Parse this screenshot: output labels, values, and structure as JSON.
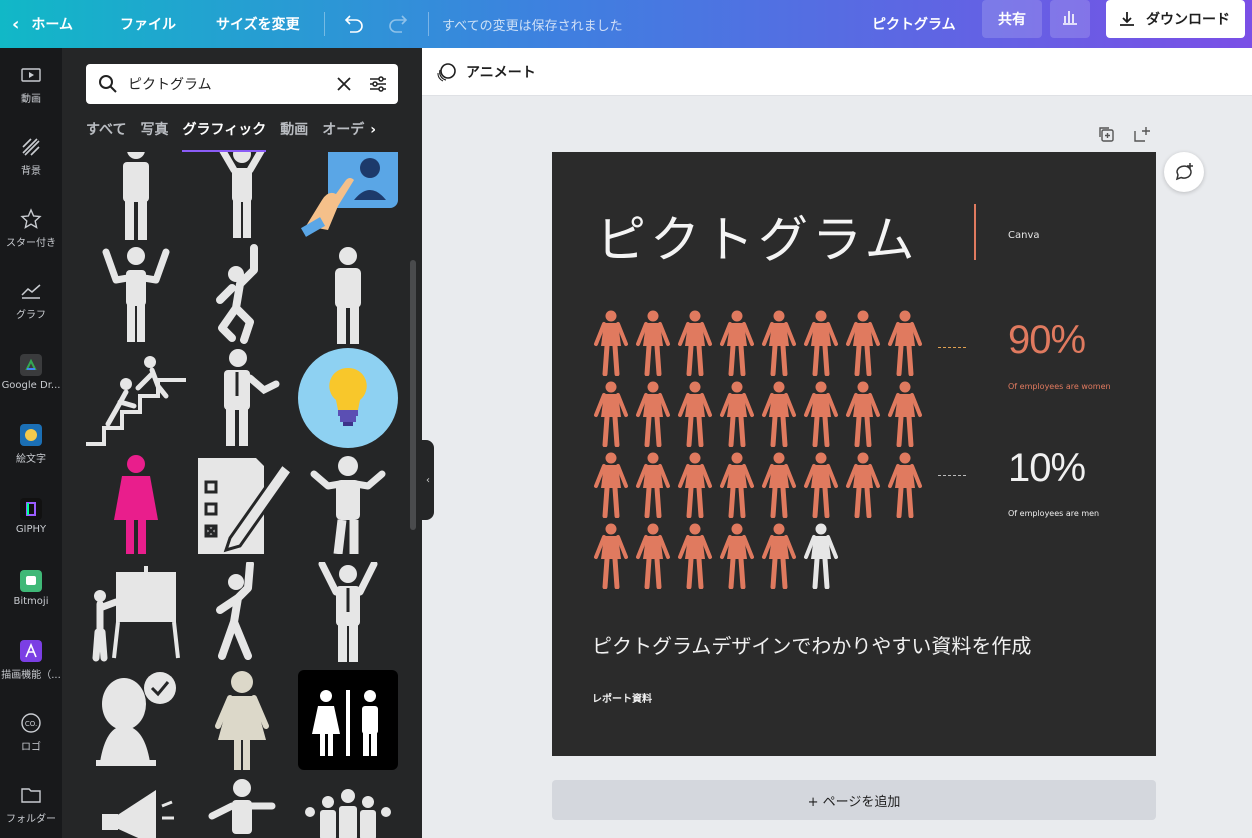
{
  "topbar": {
    "home_label": "ホーム",
    "file_label": "ファイル",
    "resize_label": "サイズを変更",
    "save_status": "すべての変更は保存されました",
    "doc_title": "ピクトグラム",
    "share_label": "共有",
    "download_label": "ダウンロード",
    "gradient_colors": [
      "#11b8c7",
      "#3f7fe0",
      "#7a4fe6"
    ]
  },
  "rail": {
    "items": [
      {
        "label": "動画",
        "icon": "video-icon"
      },
      {
        "label": "背景",
        "icon": "background-icon"
      },
      {
        "label": "スター付き",
        "icon": "star-icon"
      },
      {
        "label": "グラフ",
        "icon": "chart-icon"
      },
      {
        "label": "Google Dr...",
        "icon": "google-drive-icon"
      },
      {
        "label": "絵文字",
        "icon": "emoji-icon"
      },
      {
        "label": "GIPHY",
        "icon": "giphy-icon"
      },
      {
        "label": "Bitmoji",
        "icon": "bitmoji-icon"
      },
      {
        "label": "描画機能（...",
        "icon": "draw-icon"
      },
      {
        "label": "ロゴ",
        "icon": "logo-icon"
      },
      {
        "label": "フォルダー",
        "icon": "folder-icon"
      }
    ]
  },
  "panel": {
    "search_value": "ピクトグラム",
    "tabs": [
      "すべて",
      "写真",
      "グラフィック",
      "動画",
      "オーデ"
    ],
    "active_tab": "グラフィック",
    "active_tab_color": "#8b5cf6",
    "results": [
      "standing-person-icon",
      "cheering-person-icon",
      "pointing-hand-icon",
      "arms-up-person-icon",
      "dancing-person-icon",
      "standing-man-icon",
      "stairs-help-icon",
      "businessman-icon",
      "lightbulb-icon",
      "woman-icon",
      "checklist-pen-icon",
      "waving-person-icon",
      "whiteboard-presenter-icon",
      "dancing-woman-icon",
      "businessman-arms-up-icon",
      "approved-person-icon",
      "woman-dress-icon",
      "restroom-sign-icon",
      "megaphone-icon",
      "walking-person-icon",
      "group-icon"
    ]
  },
  "editor": {
    "animate_label": "アニメート",
    "add_page_label": "+ ページを追加"
  },
  "design": {
    "title": "ピクトグラム",
    "brand": "Canva",
    "stat1_value": "90%",
    "stat1_label": "Of employees are women",
    "stat2_value": "10%",
    "stat2_label": "Of employees are men",
    "subtitle": "ピクトグラムデザインでわかりやすい資料を作成",
    "report_label": "レポート資料",
    "women_count": 29,
    "men_count": 1,
    "women_color": "#e07a5f",
    "men_color": "#e6e6e6",
    "background_color": "#2b2b2b"
  }
}
